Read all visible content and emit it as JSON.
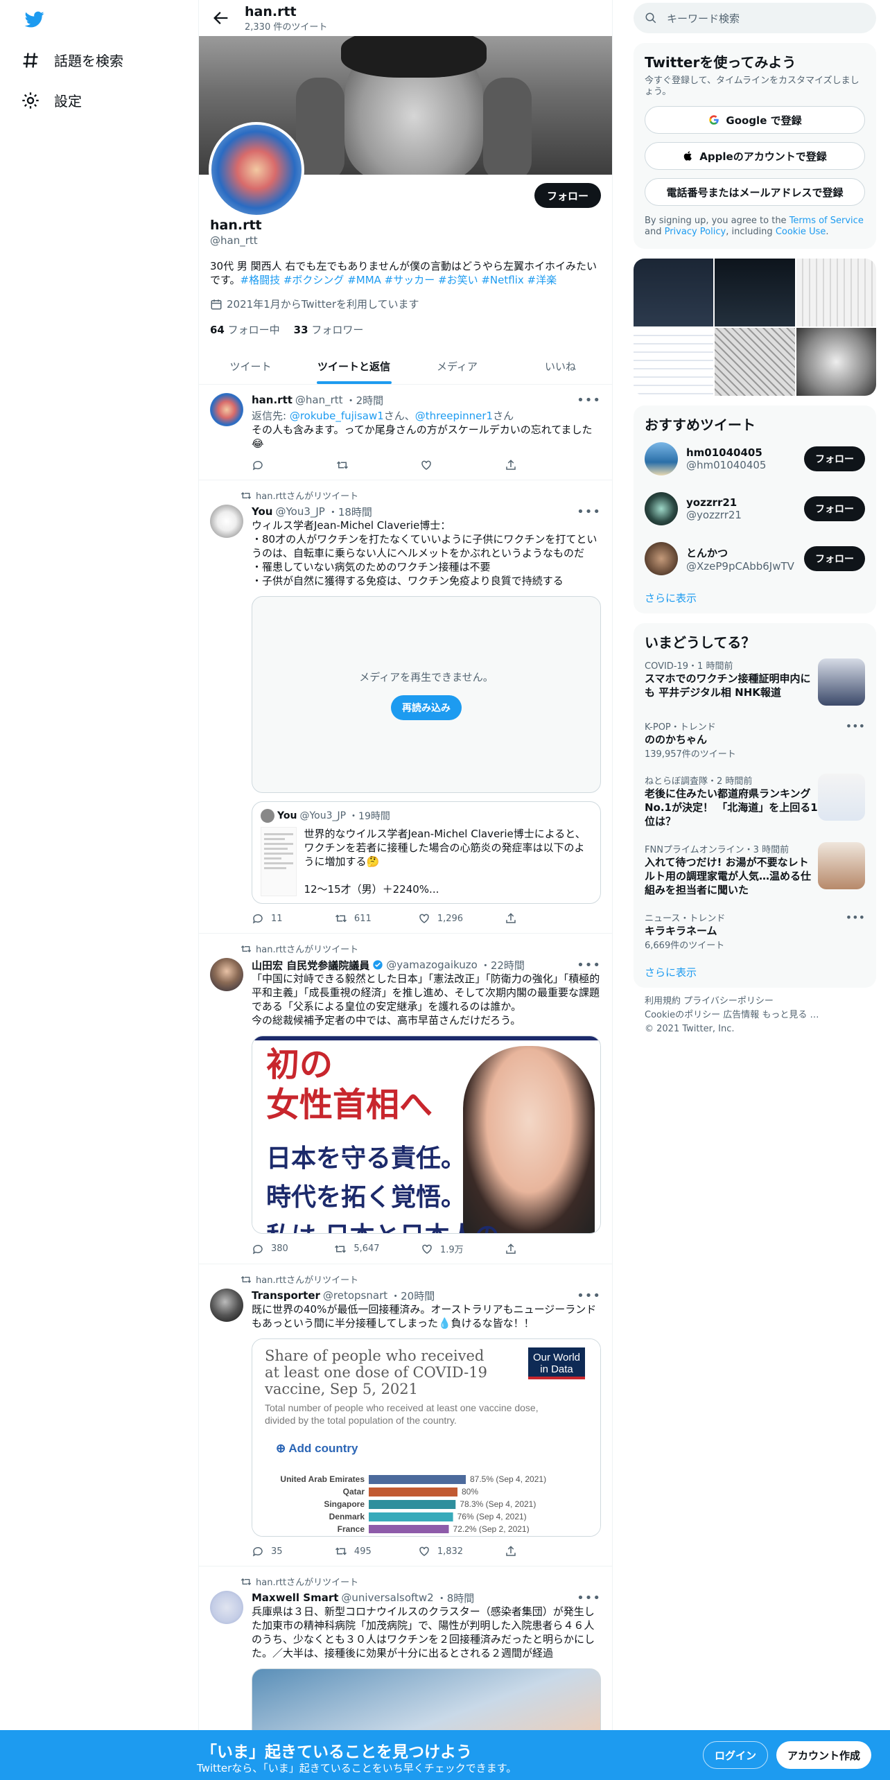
{
  "nav": {
    "explore": "話題を検索",
    "settings": "設定"
  },
  "header": {
    "name": "han.rtt",
    "tweet_count": "2,330 件のツイート"
  },
  "profile": {
    "follow_label": "フォロー",
    "name": "han.rtt",
    "handle": "@han_rtt",
    "bio_text": "30代 男 関西人 右でも左でもありませんが僕の言動はどうやら左翼ホイホイみたいです。",
    "bio_tags": "#格闘技 #ボクシング #MMA #サッカー #お笑い #Netflix #洋楽",
    "joined": "2021年1月からTwitterを利用しています",
    "following_count": "64",
    "following_label": "フォロー中",
    "followers_count": "33",
    "followers_label": "フォロワー"
  },
  "tabs": [
    "ツイート",
    "ツイートと返信",
    "メディア",
    "いいね"
  ],
  "tweets": [
    {
      "name": "han.rtt",
      "handle": "@han_rtt",
      "time": "・2時間",
      "reply_prefix": "返信先: ",
      "reply_a": "@rokube_fujisaw1",
      "reply_sep": "さん、",
      "reply_b": "@threepinner1",
      "reply_suffix": "さん",
      "text": "その人も含みます。ってか尾身さんの方がスケールデカいの忘れてました😂",
      "replies": "",
      "retweets": "",
      "likes": ""
    },
    {
      "rt": "han.rttさんがリツイート",
      "name": "You",
      "handle": "@You3_JP",
      "time": "・18時間",
      "text": "ウィルス学者Jean-Michel Claverie博士：\n・80才の人がワクチンを打たなくていいように子供にワクチンを打てというのは、自転車に乗らない人にヘルメットをかぶれというようなものだ\n・罹患していない病気のためのワクチン接種は不要\n・子供が自然に獲得する免疫は、ワクチン免疫より良質で持続する",
      "media_msg": "メディアを再生できません。",
      "reload": "再読み込み",
      "quote_name": "You",
      "quote_handle": "@You3_JP",
      "quote_time": "・19時間",
      "quote_text": "世界的なウイルス学者Jean-Michel Claverie博士によると、ワクチンを若者に接種した場合の心筋炎の発症率は以下のように増加する🤔\n\n12～15才（男）＋2240%...",
      "replies": "11",
      "retweets": "611",
      "likes": "1,296"
    },
    {
      "rt": "han.rttさんがリツイート",
      "name": "山田宏 自民党参議院議員",
      "handle": "@yamazogaikuzo",
      "time": "・22時間",
      "text": "「中国に対峙できる毅然とした日本」「憲法改正」「防衛力の強化」「積極的平和主義」「成長重視の経済」を推し進め、そして次期内閣の最重要な課題である「父系による皇位の安定継承」を護れるのは誰か。\n今の総裁候補予定者の中では、高市早苗さんだけだろう。",
      "poster_red": "初の\n女性首相へ",
      "poster_blue": "日本を守る責任。\n時代を拓く覚悟。\n私は 日本と日本人の",
      "replies": "380",
      "retweets": "5,647",
      "likes": "1.9万"
    },
    {
      "rt": "han.rttさんがリツイート",
      "name": "Transporter",
      "handle": "@retopsnart",
      "time": "・20時間",
      "text": "既に世界の40%が最低一回接種済み。オーストラリアもニュージーランドもあっという間に半分接種してしまった💧負けるな皆な！！",
      "replies": "35",
      "retweets": "495",
      "likes": "1,832"
    },
    {
      "rt": "han.rttさんがリツイート",
      "name": "Maxwell Smart",
      "handle": "@universalsoftw2",
      "time": "・8時間",
      "text": "兵庫県は３日、新型コロナウイルスのクラスター（感染者集団）が発生した加東市の精神科病院「加茂病院」で、陽性が判明した入院患者ら４６人のうち、少なくとも３０人はワクチンを２回接種済みだったと明らかにした。／大半は、接種後に効果が十分に出るとされる２週間が経過"
    }
  ],
  "chart_data": {
    "type": "bar",
    "title": "Share of people who received at least one dose of COVID-19 vaccine, Sep 5, 2021",
    "subtitle": "Total number of people who received at least one vaccine dose, divided by the total population of the country.",
    "source_logo": "Our World in Data",
    "add_country": "Add country",
    "categories": [
      "United Arab Emirates",
      "Qatar",
      "Singapore",
      "Denmark",
      "France"
    ],
    "values": [
      87.5,
      80,
      78.3,
      76,
      72.2
    ],
    "value_labels": [
      "87.5% (Sep 4, 2021)",
      "80%",
      "78.3% (Sep 4, 2021)",
      "76% (Sep 4, 2021)",
      "72.2% (Sep 2, 2021)"
    ],
    "colors": [
      "#4c6a9c",
      "#c15a32",
      "#2f8f9d",
      "#38aaba",
      "#8d5ba9"
    ],
    "xlim": [
      0,
      100
    ]
  },
  "sidebar": {
    "search_placeholder": "キーワード検索",
    "join_title": "Twitterを使ってみよう",
    "join_sub": "今すぐ登録して、タイムラインをカスタマイズしましょう。",
    "google_btn": "Google で登録",
    "apple_btn": "Appleのアカウントで登録",
    "phone_btn": "電話番号またはメールアドレスで登録",
    "terms_pre": "By signing up, you agree to the ",
    "terms_tos": "Terms of Service",
    "terms_and": " and ",
    "terms_privacy": "Privacy Policy",
    "terms_inc": ", including ",
    "terms_cookie": "Cookie Use",
    "terms_end": ".",
    "rec_title": "おすすめツイート",
    "rec": [
      {
        "name": "hm01040405",
        "handle": "@hm01040405",
        "follow": "フォロー"
      },
      {
        "name": "yozzrr21",
        "handle": "@yozzrr21",
        "follow": "フォロー"
      },
      {
        "name": "とんかつ",
        "handle": "@XzeP9pCAbb6JwTV",
        "follow": "フォロー"
      }
    ],
    "show_more": "さらに表示",
    "trends_title": "いまどうしてる？",
    "trends": [
      {
        "meta": "COVID-19・1 時間前",
        "title": "スマホでのワクチン接種証明申内にも 平井デジタル相 NHK報道",
        "count": ""
      },
      {
        "meta": "K-POP・トレンド",
        "title": "ののかちゃん",
        "count": "139,957件のツイート"
      },
      {
        "meta": "ねとらぼ調査隊・2 時間前",
        "title": "老後に住みたい都道府県ランキングNo.1が決定！ 「北海道」を上回る1位は？",
        "count": ""
      },
      {
        "meta": "FNNプライムオンライン・3 時間前",
        "title": "入れて待つだけ! お湯が不要なレトルト用の調理家電が人気…温める仕組みを担当者に聞いた",
        "count": ""
      },
      {
        "meta": "ニュース・トレンド",
        "title": "キラキラネーム",
        "count": "6,669件のツイート"
      }
    ],
    "show_more2": "さらに表示",
    "footer_1": "利用規約  プライバシーポリシー",
    "footer_2": "Cookieのポリシー  広告情報  もっと見る …",
    "footer_3": "© 2021 Twitter, Inc."
  },
  "bottom": {
    "title": "「いま」起きていることを見つけよう",
    "sub": "Twitterなら、「いま」起きていることをいち早くチェックできます。",
    "login": "ログイン",
    "signup": "アカウント作成"
  }
}
